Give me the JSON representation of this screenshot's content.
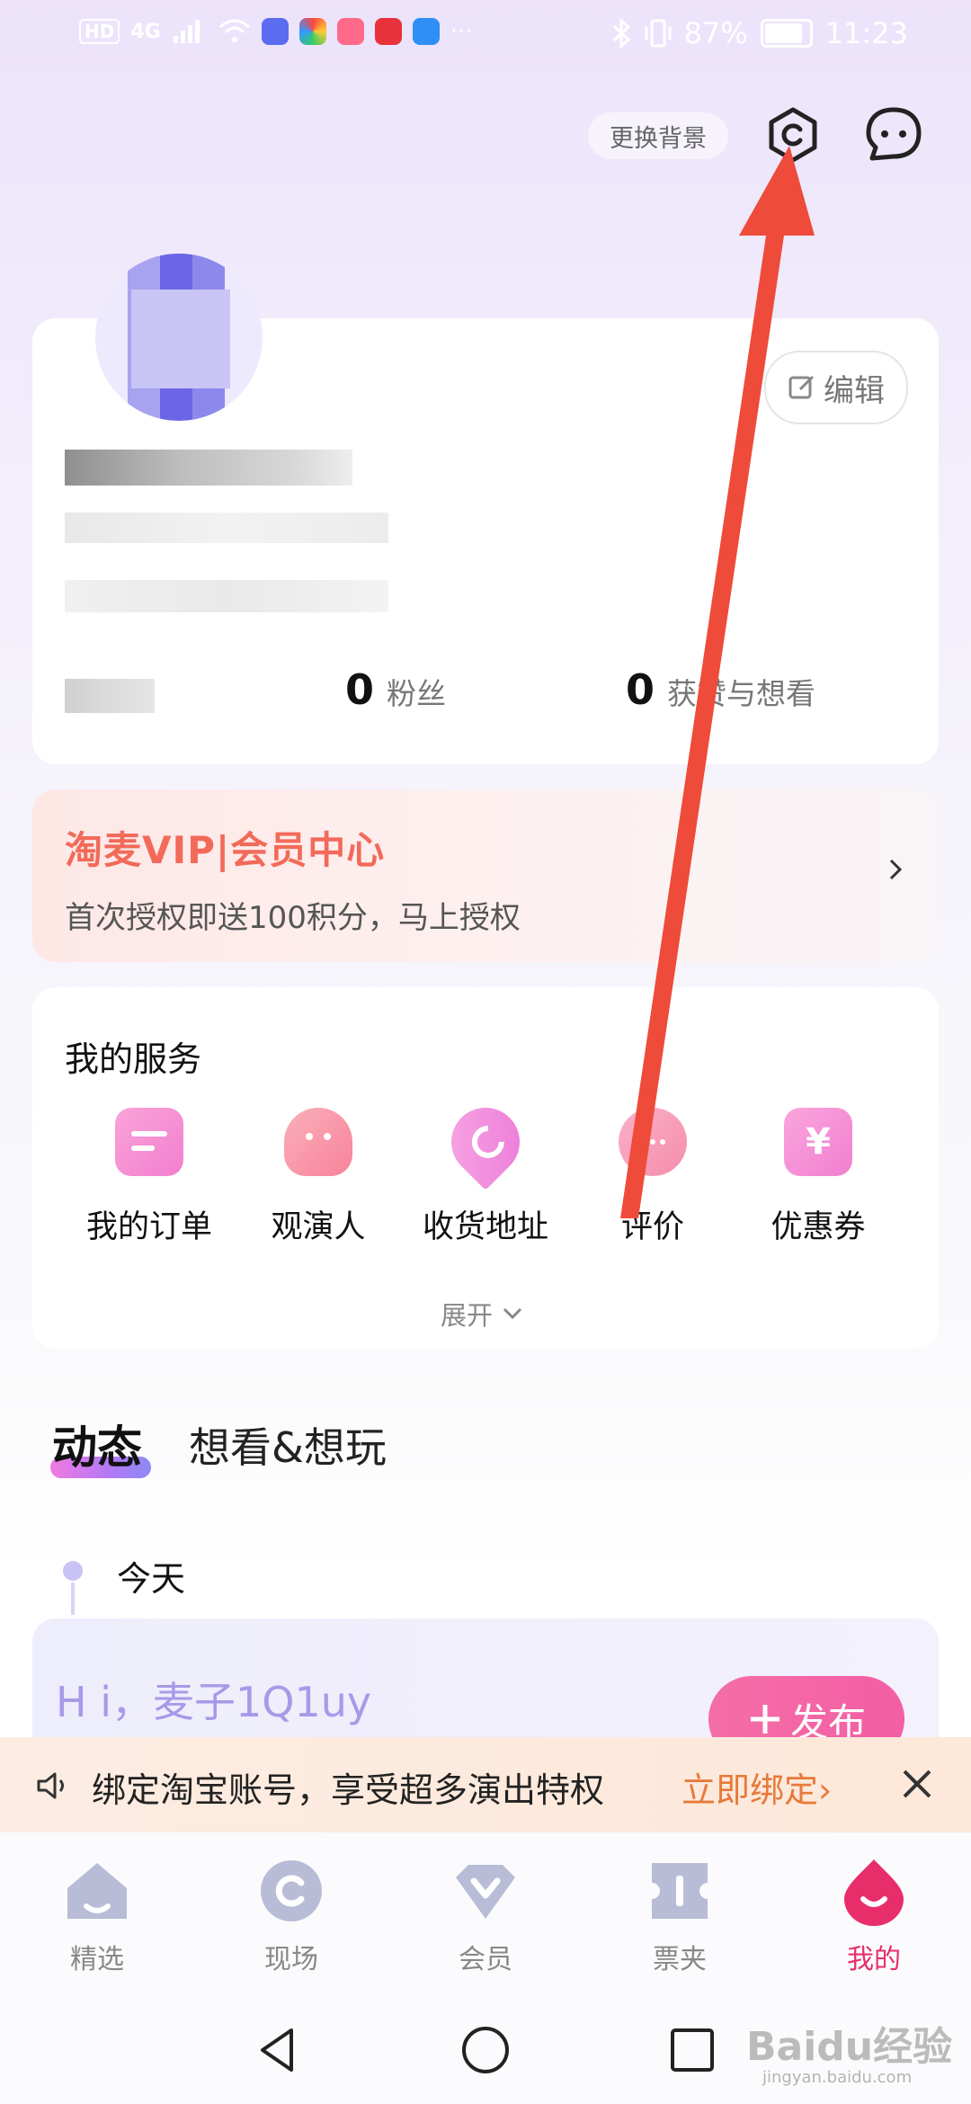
{
  "status_bar": {
    "hd": "HD",
    "network": "4G",
    "battery": "87%",
    "time": "11:23"
  },
  "top_bar": {
    "change_background": "更换背景"
  },
  "profile": {
    "edit_label": "编辑",
    "fans_count": "0",
    "fans_label": "粉丝",
    "likes_count": "0",
    "likes_label": "获赞与想看"
  },
  "vip": {
    "title": "淘麦VIP|会员中心",
    "subtitle": "首次授权即送100积分，马上授权"
  },
  "services": {
    "title": "我的服务",
    "items": [
      {
        "label": "我的订单",
        "icon": "order-icon",
        "color": "#f58fd7"
      },
      {
        "label": "观演人",
        "icon": "audience-icon",
        "color": "#fb8fa8"
      },
      {
        "label": "收货地址",
        "icon": "address-icon",
        "color": "#f38fe0"
      },
      {
        "label": "评价",
        "icon": "review-icon",
        "color": "#f79ac0"
      },
      {
        "label": "优惠券",
        "icon": "coupon-icon",
        "color": "#f590d3"
      }
    ],
    "expand_label": "展开"
  },
  "tabs": {
    "active": "动态",
    "inactive": "想看&想玩"
  },
  "timeline": {
    "today": "今天"
  },
  "feed": {
    "greeting": "H i，麦子1Q1uy",
    "publish_label": "发布"
  },
  "taobao_banner": {
    "text": "绑定淘宝账号，享受超多演出特权",
    "link": "立即绑定"
  },
  "bottom_nav": [
    {
      "label": "精选",
      "icon": "home-icon",
      "active": false
    },
    {
      "label": "现场",
      "icon": "live-icon",
      "active": false
    },
    {
      "label": "会员",
      "icon": "member-icon",
      "active": false
    },
    {
      "label": "票夹",
      "icon": "ticket-icon",
      "active": false
    },
    {
      "label": "我的",
      "icon": "mine-icon",
      "active": true
    }
  ],
  "watermark": {
    "main": "Baidu经验",
    "sub": "jingyan.baidu.com"
  },
  "colors": {
    "accent_pink": "#e82d6b",
    "vip_orange": "#f26a5a",
    "annotation_arrow": "#ee4b3b"
  }
}
